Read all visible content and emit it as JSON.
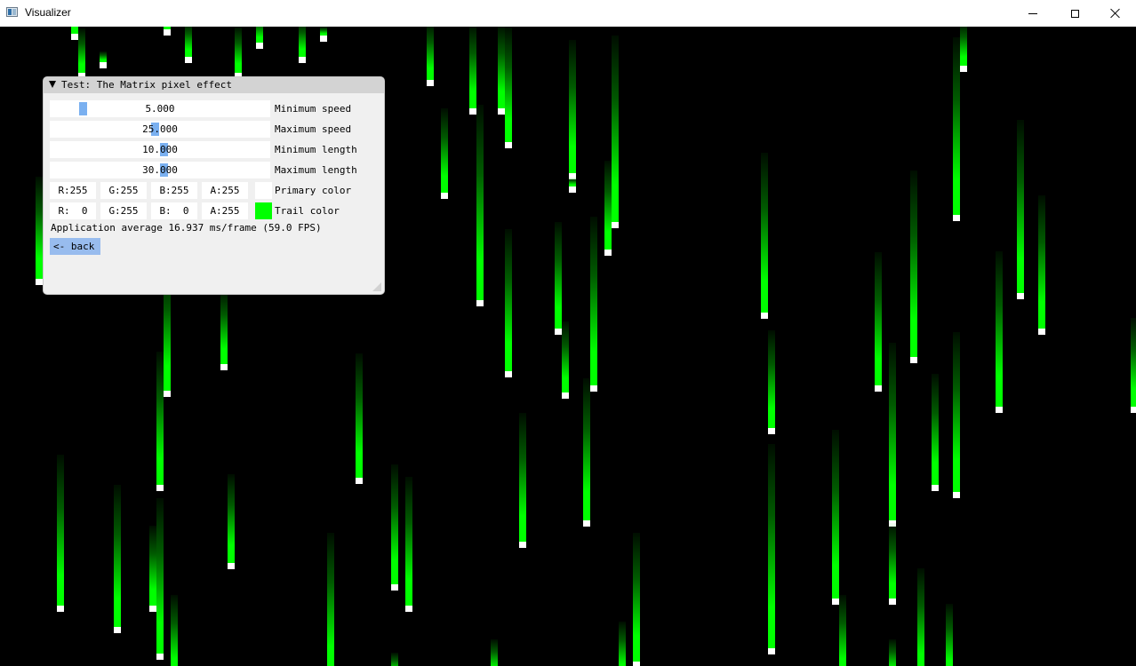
{
  "window": {
    "title": "Visualizer",
    "icon": "app-window-icon",
    "controls": [
      "minimize-icon",
      "maximize-icon",
      "close-icon"
    ]
  },
  "panel": {
    "title": "Test: The Matrix pixel effect",
    "sliders": [
      {
        "label": "Minimum speed",
        "value": "5.000",
        "fraction": 0.14
      },
      {
        "label": "Maximum speed",
        "value": "25.000",
        "fraction": 0.475
      },
      {
        "label": "Minimum length",
        "value": "10.000",
        "fraction": 0.52
      },
      {
        "label": "Maximum length",
        "value": "30.000",
        "fraction": 0.52
      }
    ],
    "primary_color": {
      "label": "Primary color",
      "r": "R:255",
      "g": "G:255",
      "b": "B:255",
      "a": "A:255",
      "swatch": "#ffffff"
    },
    "trail_color": {
      "label": "Trail color",
      "r": "R:  0",
      "g": "G:255",
      "b": "B:  0",
      "a": "A:255",
      "swatch": "#00ff00"
    },
    "info": "Application average 16.937 ms/frame (59.0 FPS)",
    "back_label": "<- back"
  },
  "colors": {
    "background": "#000000",
    "trail": "#00ff00",
    "head": "#ffffff",
    "slider_grab": "#7ab0f0",
    "button": "#98bcee"
  }
}
